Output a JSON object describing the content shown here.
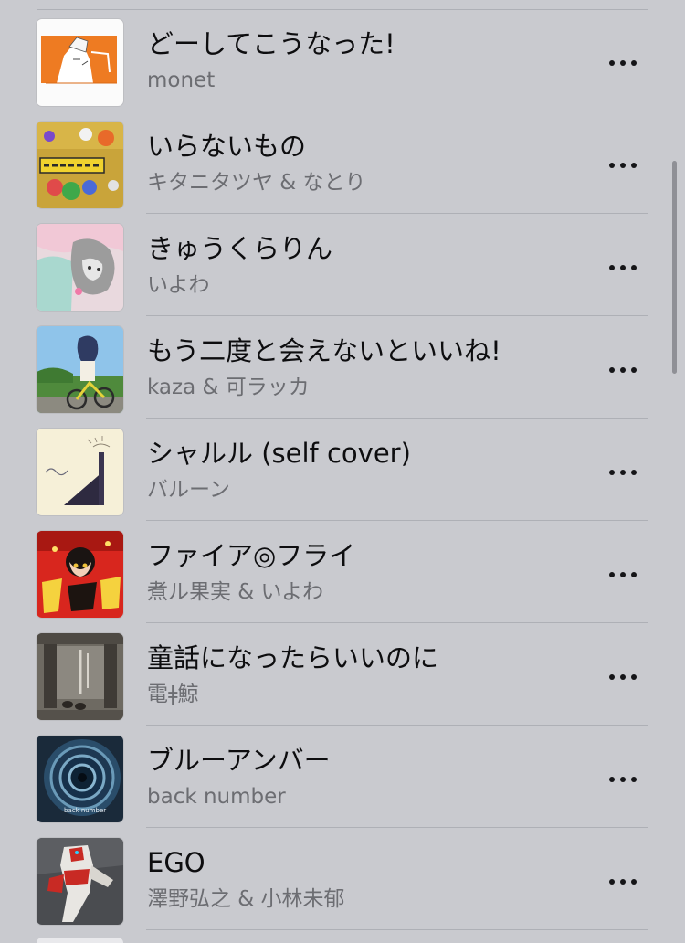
{
  "songs": [
    {
      "title": "どーしてこうなった!",
      "artist": "monet",
      "artwork": "orange-figure-art"
    },
    {
      "title": "いらないもの",
      "artist": "キタニタツヤ & なとり",
      "artwork": "yellow-collage-art"
    },
    {
      "title": "きゅうくらりん",
      "artist": "いよわ",
      "artwork": "pink-girl-art"
    },
    {
      "title": "もう二度と会えないといいね!",
      "artist": "kaza & 可ラッカ",
      "artwork": "bicycle-girl-art"
    },
    {
      "title": "シャルル (self cover)",
      "artist": "バルーン",
      "artwork": "cream-wing-art"
    },
    {
      "title": "ファイア◎フライ",
      "artist": "煮ル果実 & いよわ",
      "artwork": "red-firefly-art"
    },
    {
      "title": "童話になったらいいのに",
      "artist": "電ǂ鯨",
      "artwork": "room-photo-art"
    },
    {
      "title": "ブルーアンバー",
      "artist": "back number",
      "artwork": "spiral-staircase-art",
      "artwork_text": "back number"
    },
    {
      "title": "EGO",
      "artist": "澤野弘之 & 小林未郁",
      "artwork": "robot-art"
    }
  ],
  "colors": {
    "background": "#c9cacf",
    "title": "#0d0d0f",
    "subtitle": "#6c6d72",
    "divider": "#aeb0b6",
    "scrollbar": "#8f9096"
  }
}
